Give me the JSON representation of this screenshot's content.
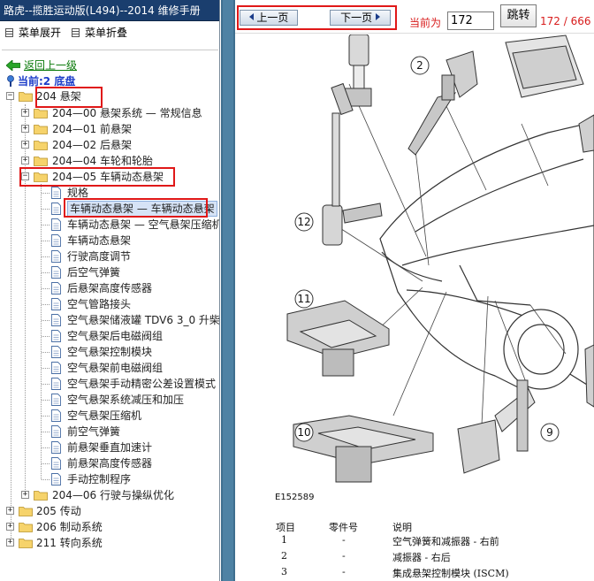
{
  "app": {
    "title": "路虎--揽胜运动版(L494)--2014 维修手册"
  },
  "menu": {
    "expand_label": "菜单展开",
    "collapse_label": "菜单折叠"
  },
  "nav": {
    "back_label": "返回上一级",
    "current_label": "当前:2 底盘"
  },
  "tree": {
    "root_items": [
      {
        "label": "204 悬架"
      },
      {
        "label": "205 传动"
      },
      {
        "label": "206 制动系统"
      },
      {
        "label": "211 转向系统"
      }
    ],
    "sub_items": [
      {
        "label": "204—00 悬架系统 — 常规信息"
      },
      {
        "label": "204—01 前悬架"
      },
      {
        "label": "204—02 后悬架"
      },
      {
        "label": "204—04 车轮和轮胎"
      },
      {
        "label": "204—05 车辆动态悬架"
      },
      {
        "label": "204—06 行驶与操纵优化"
      }
    ],
    "docs": [
      {
        "label": "规格"
      },
      {
        "label": "车辆动态悬架 — 车辆动态悬架"
      },
      {
        "label": "车辆动态悬架 — 空气悬架压缩机"
      },
      {
        "label": "车辆动态悬架"
      },
      {
        "label": "行驶高度调节"
      },
      {
        "label": "后空气弹簧"
      },
      {
        "label": "后悬架高度传感器"
      },
      {
        "label": "空气管路接头"
      },
      {
        "label": "空气悬架储液罐 TDV6 3_0 升柴"
      },
      {
        "label": "空气悬架后电磁阀组"
      },
      {
        "label": "空气悬架控制模块"
      },
      {
        "label": "空气悬架前电磁阀组"
      },
      {
        "label": "空气悬架手动精密公差设置模式"
      },
      {
        "label": "空气悬架系统减压和加压"
      },
      {
        "label": "空气悬架压缩机"
      },
      {
        "label": "前空气弹簧"
      },
      {
        "label": "前悬架垂直加速计"
      },
      {
        "label": "前悬架高度传感器"
      },
      {
        "label": "手动控制程序"
      }
    ]
  },
  "pager": {
    "prev_label": "上一页",
    "next_label": "下一页",
    "current_prefix": "当前为",
    "page_value": "172",
    "go_label": "跳转",
    "page_count": "172 / 666"
  },
  "figure": {
    "id_text": "E152589",
    "callouts": [
      "2",
      "12",
      "11",
      "10",
      "9"
    ],
    "legend_headers": {
      "item": "项目",
      "part": "零件号",
      "desc": "说明"
    },
    "legend_rows": [
      {
        "item": "1",
        "part": "-",
        "desc": "空气弹簧和减振器 - 右前"
      },
      {
        "item": "2",
        "part": "-",
        "desc": "减振器 - 右后"
      },
      {
        "item": "3",
        "part": "-",
        "desc": "集成悬架控制模块 (ISCM)"
      }
    ]
  },
  "colors": {
    "title_bar": "#1a3e6e",
    "highlight_red": "#e01818",
    "link_green": "#0a7a0a",
    "current_blue": "#1b3cc8",
    "pager_red": "#d81c1c"
  }
}
